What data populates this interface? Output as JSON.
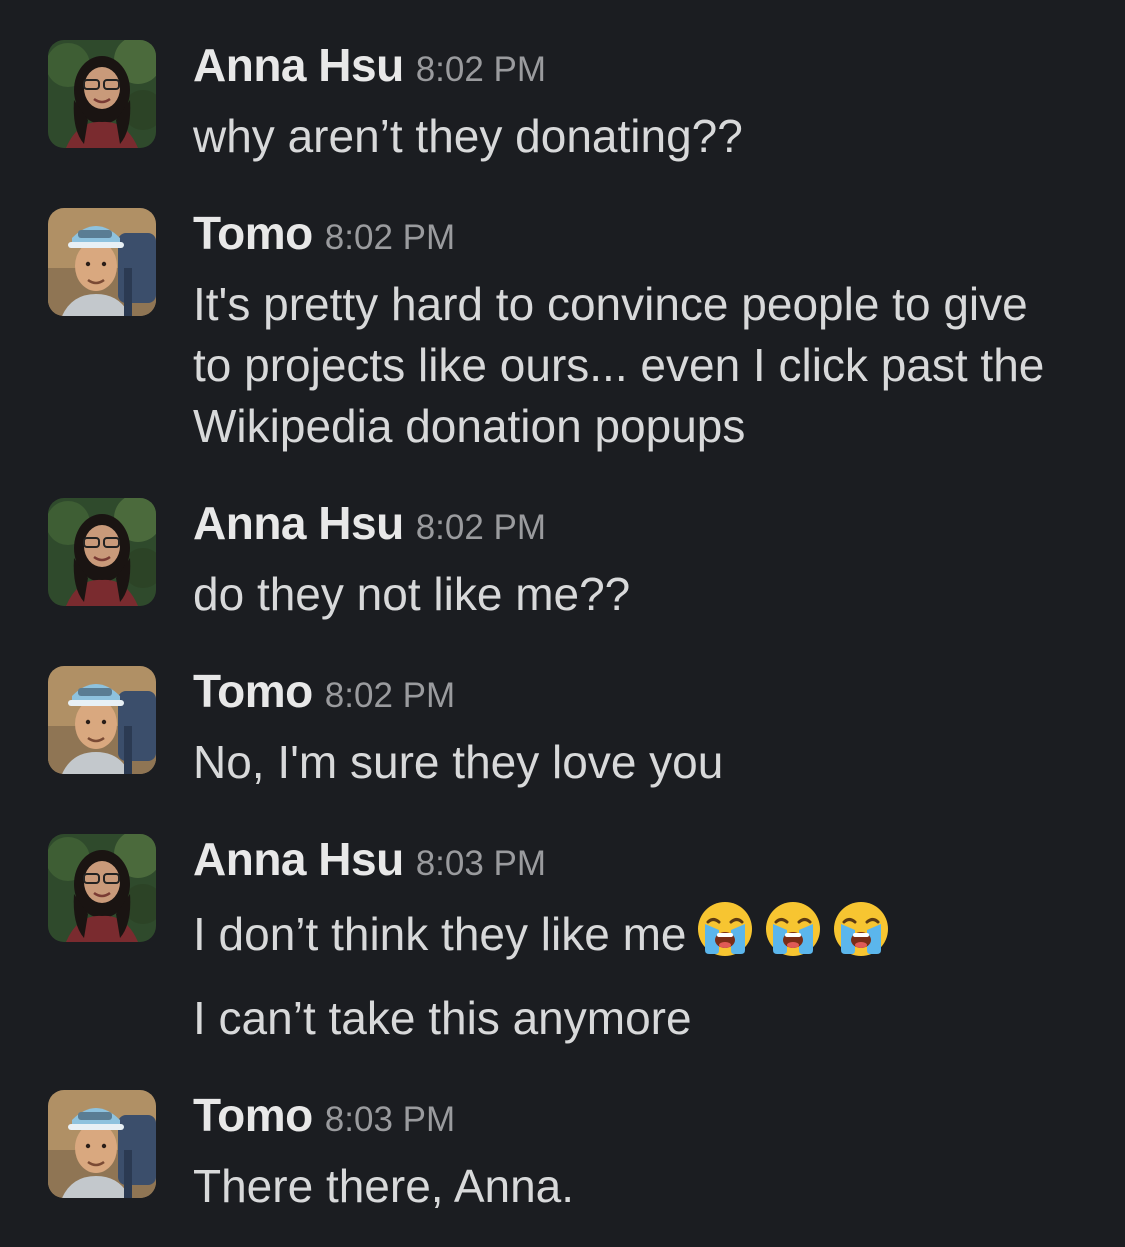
{
  "messages": [
    {
      "author": "Anna Hsu",
      "avatar": "anna-avatar",
      "time": "8:02 PM",
      "text": "why aren’t they donating??"
    },
    {
      "author": "Tomo",
      "avatar": "tomo-avatar",
      "time": "8:02 PM",
      "text": "It's pretty hard to convince people to give to projects like ours... even I click past the Wikipedia donation popups"
    },
    {
      "author": "Anna Hsu",
      "avatar": "anna-avatar",
      "time": "8:02 PM",
      "text": "do they not like me??"
    },
    {
      "author": "Tomo",
      "avatar": "tomo-avatar",
      "time": "8:02 PM",
      "text": "No, I'm sure they love you"
    },
    {
      "author": "Anna Hsu",
      "avatar": "anna-avatar",
      "time": "8:03 PM",
      "text": "I don’t think they like me",
      "emoji": [
        "loudly-crying-face",
        "loudly-crying-face",
        "loudly-crying-face"
      ],
      "followup": "I can’t take this anymore"
    },
    {
      "author": "Tomo",
      "avatar": "tomo-avatar",
      "time": "8:03 PM",
      "text": "There there, Anna."
    }
  ],
  "colors": {
    "background": "#1b1d21",
    "name": "#e8e8e8",
    "timestamp": "#9a9b9e",
    "text": "#d8d9da"
  }
}
